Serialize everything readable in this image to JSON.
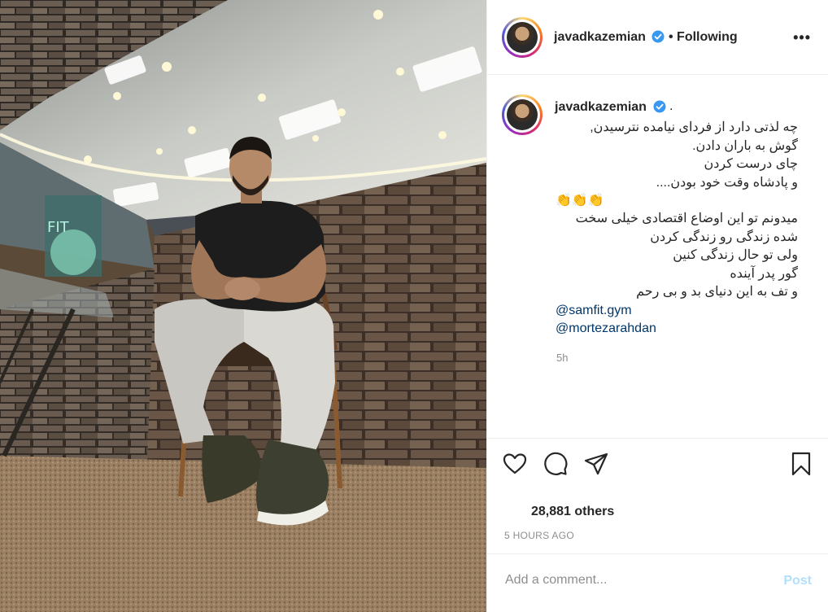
{
  "post": {
    "author": {
      "username": "javadkazemian",
      "verified": true,
      "follow_status": "• Following",
      "more_glyph": "•••"
    },
    "caption": {
      "username": "javadkazemian",
      "suffix": ".",
      "lines": [
        "چه لذتی دارد از فردای نیامده نترسیدن,",
        "گوش به باران دادن.",
        "چای درست کردن",
        "و پادشاه وقت خود بودن....",
        "👏👏👏",
        "میدونم تو این اوضاع اقتصادی خیلی سخت",
        "شده زندگی رو زندگی کردن",
        "ولی تو حال زندگی کنین",
        "گور پدر آینده",
        "و تف به این دنیای بد و بی رحم"
      ],
      "mentions": [
        "@samfit.gym",
        "@mortezarahdan"
      ],
      "time": "5h"
    },
    "actions": {
      "like_icon": "heart-outline-icon",
      "comment_icon": "speech-bubble-icon",
      "share_icon": "paper-plane-icon",
      "save_icon": "bookmark-outline-icon"
    },
    "likes_text": "28,881 others",
    "timestamp": "5 HOURS AGO",
    "comment": {
      "placeholder": "Add a comment...",
      "post_label": "Post"
    },
    "colors": {
      "text": "#262626",
      "secondary": "#8e8e8e",
      "link": "#00376b",
      "verified": "#3897f0",
      "post_disabled": "#b2dffc",
      "border": "#efefef"
    }
  }
}
